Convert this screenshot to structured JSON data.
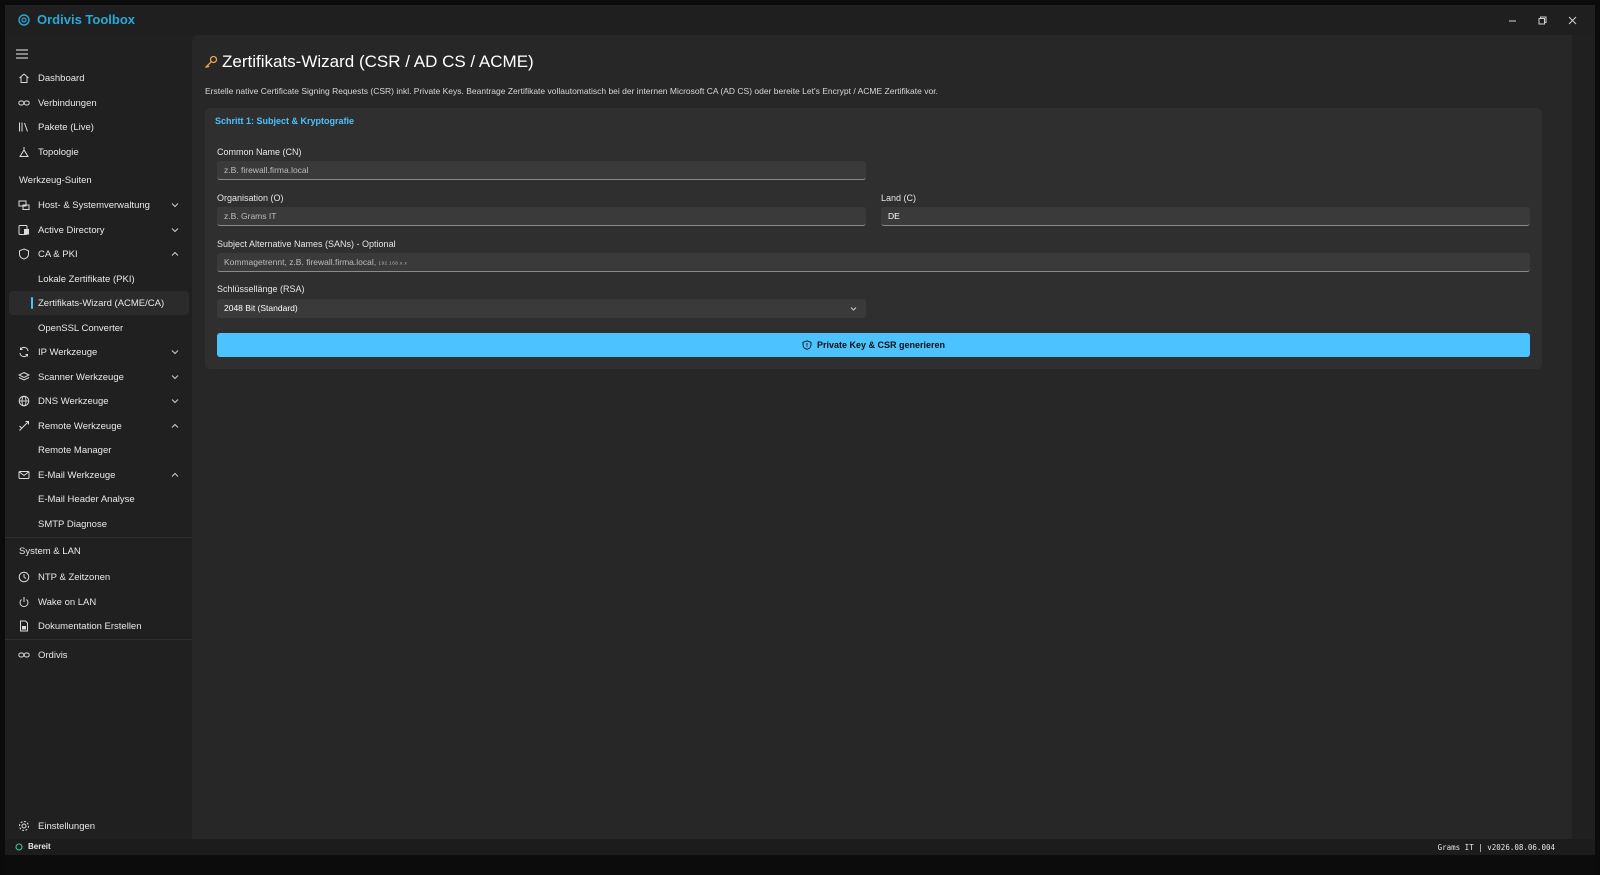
{
  "window": {
    "title": "Ordivis Toolbox",
    "controls": {
      "minimize": "—",
      "maximize": "❐",
      "close": "✕"
    }
  },
  "sidebar": {
    "top_items": [
      {
        "label": "Dashboard",
        "icon": "home-icon"
      },
      {
        "label": "Verbindungen",
        "icon": "link-icon"
      },
      {
        "label": "Pakete (Live)",
        "icon": "library-icon"
      },
      {
        "label": "Topologie",
        "icon": "topology-icon"
      }
    ],
    "section_tools": "Werkzeug-Suiten",
    "tools": [
      {
        "label": "Host- & Systemverwaltung",
        "icon": "host-icon",
        "expanded": false
      },
      {
        "label": "Active Directory",
        "icon": "directory-icon",
        "expanded": false
      },
      {
        "label": "CA & PKI",
        "icon": "shield-icon",
        "expanded": true
      },
      {
        "label": "Lokale Zertifikate (PKI)",
        "sub": true
      },
      {
        "label": "Zertifikats-Wizard (ACME/CA)",
        "sub": true,
        "active": true
      },
      {
        "label": "OpenSSL Converter",
        "sub": true
      },
      {
        "label": "IP Werkzeuge",
        "icon": "refresh-icon",
        "expanded": false
      },
      {
        "label": "Scanner Werkzeuge",
        "icon": "layers-icon",
        "expanded": false
      },
      {
        "label": "DNS Werkzeuge",
        "icon": "globe-icon",
        "expanded": false
      },
      {
        "label": "Remote Werkzeuge",
        "icon": "remote-icon",
        "expanded": true
      },
      {
        "label": "Remote Manager",
        "sub": true
      },
      {
        "label": "E-Mail Werkzeuge",
        "icon": "mail-icon",
        "expanded": true
      },
      {
        "label": "E-Mail Header Analyse",
        "sub": true
      },
      {
        "label": "SMTP Diagnose",
        "sub": true
      }
    ],
    "section_system": "System & LAN",
    "system": [
      {
        "label": "NTP & Zeitzonen",
        "icon": "clock-icon"
      },
      {
        "label": "Wake on LAN",
        "icon": "power-icon"
      },
      {
        "label": "Dokumentation Erstellen",
        "icon": "document-icon"
      }
    ],
    "ordivis": "Ordivis",
    "settings": "Einstellungen"
  },
  "page": {
    "title": "Zertifikats-Wizard (CSR / AD CS / ACME)",
    "description": "Erstelle native Certificate Signing Requests (CSR) inkl. Private Keys. Beantrage Zertifikate vollautomatisch bei der internen Microsoft CA (AD CS) oder bereite Let's Encrypt / ACME Zertifikate vor.",
    "accent": "#4cc2ff"
  },
  "form": {
    "step_title": "Schritt 1: Subject & Kryptografie",
    "cn_label": "Common Name (CN)",
    "cn_placeholder": "z.B. firewall.firma.local",
    "org_label": "Organisation (O)",
    "org_placeholder": "z.B. Grams IT",
    "country_label": "Land (C)",
    "country_value": "DE",
    "san_label": "Subject Alternative Names (SANs) - Optional",
    "san_placeholder": "Kommagetrennt, z.B. firewall.firma.local,",
    "san_placeholder_tail": "192.168.x.x",
    "key_label": "Schlüssellänge (RSA)",
    "key_value": "2048 Bit (Standard)",
    "generate_button": "Private Key & CSR generieren"
  },
  "status": {
    "state": "Bereit",
    "version": "Grams IT | v2026.08.06.004"
  }
}
